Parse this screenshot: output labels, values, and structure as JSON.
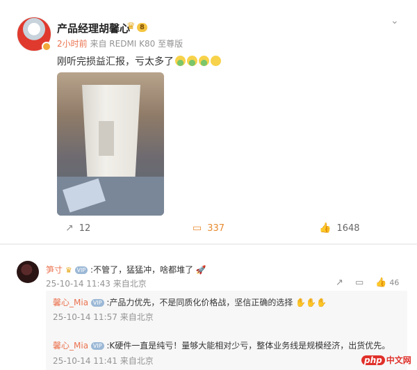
{
  "post": {
    "author": "产品经理胡馨心",
    "vip_badge": "8",
    "time": "2小时前",
    "source": "来自 REDMI K80 至尊版",
    "text": "刚听完损益汇报，亏太多了",
    "emojis": [
      "cry",
      "cry",
      "cry",
      "smile"
    ],
    "actions": {
      "repost_count": "12",
      "comment_count": "337",
      "like_count": "1648"
    }
  },
  "comments": [
    {
      "user": "笋寸",
      "text": ":不管了，猛猛冲，啥都堆了",
      "time": "25-10-14 11:43",
      "source": "来自北京",
      "like_count": "46"
    }
  ],
  "replies": [
    {
      "user": "馨心_Mia",
      "text": ":产品力优先，不是同质化价格战，坚信正确的选择",
      "time": "25-10-14 11:57",
      "source": "来自北京"
    },
    {
      "user": "馨心_Mia",
      "text": ":K硬件一直是纯亏！量够大能相对少亏，整体业务线是规模经济，出货优先。",
      "time": "25-10-14 11:41",
      "source": "来自北京"
    }
  ],
  "watermark": {
    "php": "php",
    "cn": "中文网"
  },
  "colors": {
    "accent_orange": "#eb7350",
    "comment_active": "#e88a2f",
    "reply_bg": "#f7f7f7"
  }
}
